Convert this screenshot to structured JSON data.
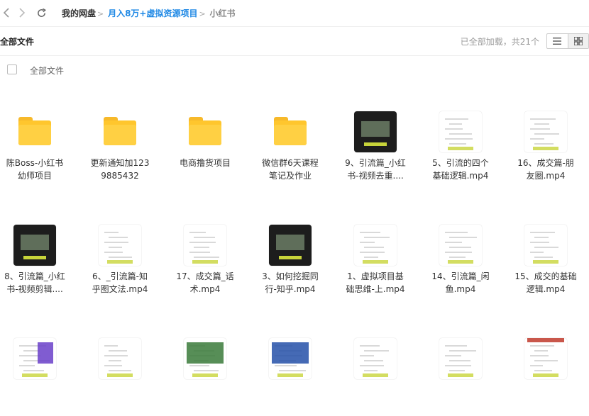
{
  "nav": {
    "back_icon": "chevron-left-icon",
    "forward_icon": "chevron-right-icon",
    "refresh_icon": "refresh-icon"
  },
  "breadcrumb": {
    "root": "我的网盘",
    "mid": "月入8万+虚拟资源项目",
    "current": "小红书",
    "separator": ">"
  },
  "header": {
    "title": "全部文件",
    "status": "已全部加载，共21个",
    "list_view_icon": "list-view-icon",
    "grid_view_icon": "grid-view-icon"
  },
  "select_all": {
    "label": "全部文件"
  },
  "files": [
    {
      "line1": "陈Boss-小红书",
      "line2": "幼师项目",
      "type": "folder"
    },
    {
      "line1": "更新通知加123",
      "line2": "9885432",
      "type": "folder"
    },
    {
      "line1": "电商撸货项目",
      "line2": "",
      "type": "folder"
    },
    {
      "line1": "微信群6天课程",
      "line2": "笔记及作业",
      "type": "folder"
    },
    {
      "line1": "9、引流篇_小红",
      "line2": "书-视频去重....",
      "type": "video",
      "theme": "dark"
    },
    {
      "line1": "5、引流的四个",
      "line2": "基础逻辑.mp4",
      "type": "video",
      "theme": "light"
    },
    {
      "line1": "16、成交篇-朋",
      "line2": "友圈.mp4",
      "type": "video",
      "theme": "light"
    },
    {
      "line1": "8、引流篇_小红",
      "line2": "书-视频剪辑....",
      "type": "video",
      "theme": "dark"
    },
    {
      "line1": "6、_引流篇-知",
      "line2": "乎图文法.mp4",
      "type": "video",
      "theme": "light"
    },
    {
      "line1": "17、成交篇_话",
      "line2": "术.mp4",
      "type": "video",
      "theme": "light"
    },
    {
      "line1": "3、如何挖掘同",
      "line2": "行-知乎.mp4",
      "type": "video",
      "theme": "dark"
    },
    {
      "line1": "1、虚拟项目基",
      "line2": "础思维-上.mp4",
      "type": "video",
      "theme": "light"
    },
    {
      "line1": "14、引流篇_闲",
      "line2": "鱼.mp4",
      "type": "video",
      "theme": "light"
    },
    {
      "line1": "15、成交的基础",
      "line2": "逻辑.mp4",
      "type": "video",
      "theme": "light"
    },
    {
      "line1": "",
      "line2": "",
      "type": "video",
      "theme": "purple"
    },
    {
      "line1": "",
      "line2": "",
      "type": "video",
      "theme": "light"
    },
    {
      "line1": "",
      "line2": "",
      "type": "video",
      "theme": "green"
    },
    {
      "line1": "",
      "line2": "",
      "type": "video",
      "theme": "blue"
    },
    {
      "line1": "",
      "line2": "",
      "type": "video",
      "theme": "light"
    },
    {
      "line1": "",
      "line2": "",
      "type": "video",
      "theme": "light"
    },
    {
      "line1": "",
      "line2": "",
      "type": "video",
      "theme": "red"
    }
  ]
}
